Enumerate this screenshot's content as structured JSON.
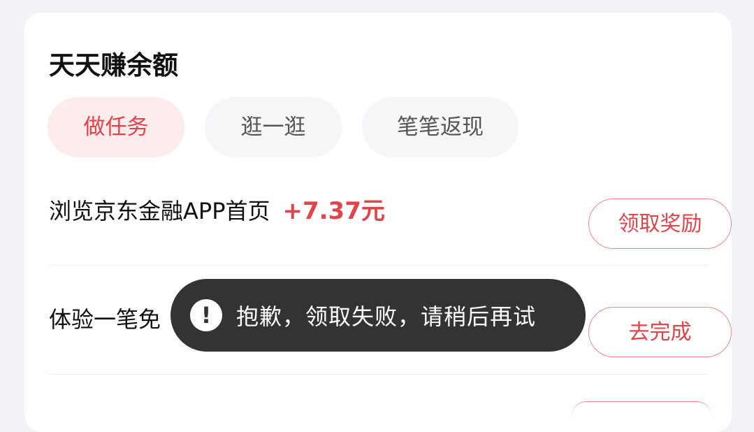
{
  "section": {
    "title": "天天赚余额"
  },
  "tabs": [
    {
      "label": "做任务",
      "active": true
    },
    {
      "label": "逛一逛",
      "active": false
    },
    {
      "label": "笔笔返现",
      "active": false
    }
  ],
  "tasks": [
    {
      "title": "浏览京东金融APP首页",
      "reward": "+7.37元",
      "button": "领取奖励"
    },
    {
      "title": "体验一笔免",
      "reward": "",
      "button": "去完成"
    }
  ],
  "toast": {
    "icon": "exclamation-icon",
    "icon_glyph": "!",
    "message": "抱歉，领取失败，请稍后再试"
  },
  "colors": {
    "accent": "#e0454b",
    "tab_active_bg": "#fdecec",
    "toast_bg": "#333333",
    "page_bg": "#f2f2f7"
  }
}
